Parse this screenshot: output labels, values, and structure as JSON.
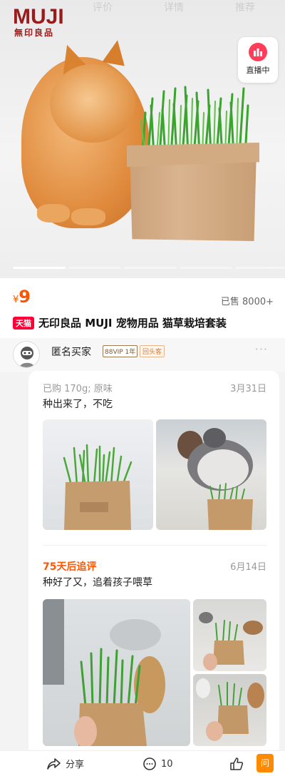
{
  "top_tabs": [
    "评价",
    "详情",
    "推荐"
  ],
  "brand": {
    "logo_text": "MUJI",
    "logo_sub": "無印良品"
  },
  "live": {
    "label": "直播中"
  },
  "product": {
    "currency": "¥",
    "price": "9",
    "sold": "已售 8000+",
    "store_badge": "天猫",
    "title": "无印良品 MUJI 宠物用品 猫草栽培套装"
  },
  "reviewer": {
    "name": "匿名买家",
    "vip_badge": "88VIP 1年",
    "repeat_badge": "回头客",
    "more": "···"
  },
  "review": {
    "spec": "已购 170g; 原味",
    "date": "3月31日",
    "text": "种出来了，不吃"
  },
  "follow_up": {
    "label": "75天后追评",
    "date": "6月14日",
    "text": "种好了又，追着孩子喂草"
  },
  "footer": {
    "share": "分享",
    "comments": "10",
    "ask": "问"
  }
}
